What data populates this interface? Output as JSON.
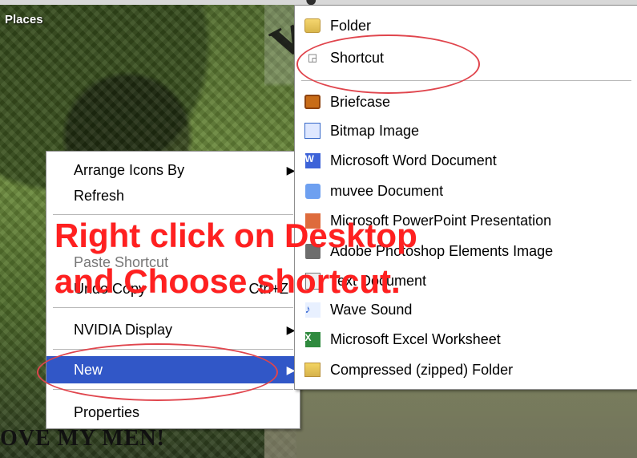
{
  "desktop": {
    "places_label": "Places",
    "bottom_text": "OVE MY MEN!",
    "deco_text": "wi"
  },
  "context_menu": {
    "items": [
      {
        "label": "Arrange Icons By",
        "has_submenu": true,
        "enabled": true
      },
      {
        "label": "Refresh",
        "has_submenu": false,
        "enabled": true
      },
      {
        "label": "Paste Shortcut",
        "has_submenu": false,
        "enabled": false
      },
      {
        "label": "Undo Copy",
        "shortcut": "Ctrl+Z",
        "has_submenu": false,
        "enabled": true
      },
      {
        "label": "NVIDIA Display",
        "has_submenu": true,
        "enabled": true
      },
      {
        "label": "New",
        "has_submenu": true,
        "enabled": true,
        "selected": true
      },
      {
        "label": "Properties",
        "has_submenu": false,
        "enabled": true
      }
    ]
  },
  "submenu": {
    "items": [
      {
        "label": "Folder",
        "icon": "folder-icon"
      },
      {
        "label": "Shortcut",
        "icon": "shortcut-icon"
      },
      {
        "label": "Briefcase",
        "icon": "briefcase-icon"
      },
      {
        "label": "Bitmap Image",
        "icon": "bitmap-icon"
      },
      {
        "label": "Microsoft Word Document",
        "icon": "word-document-icon"
      },
      {
        "label": "muvee Document",
        "icon": "muvee-document-icon"
      },
      {
        "label": "Microsoft PowerPoint Presentation",
        "icon": "powerpoint-icon"
      },
      {
        "label": "Adobe Photoshop Elements Image",
        "icon": "photoshop-icon"
      },
      {
        "label": "Text Document",
        "icon": "text-document-icon"
      },
      {
        "label": "Wave Sound",
        "icon": "wave-sound-icon"
      },
      {
        "label": "Microsoft Excel Worksheet",
        "icon": "excel-icon"
      },
      {
        "label": "Compressed (zipped) Folder",
        "icon": "zip-folder-icon"
      }
    ]
  },
  "annotation": {
    "line1": "Right click on Desktop",
    "line2": "and Choose shortcut."
  },
  "colors": {
    "highlight": "#3157c7",
    "annotation_red": "#ff2020",
    "circle_red": "#e0454d"
  }
}
